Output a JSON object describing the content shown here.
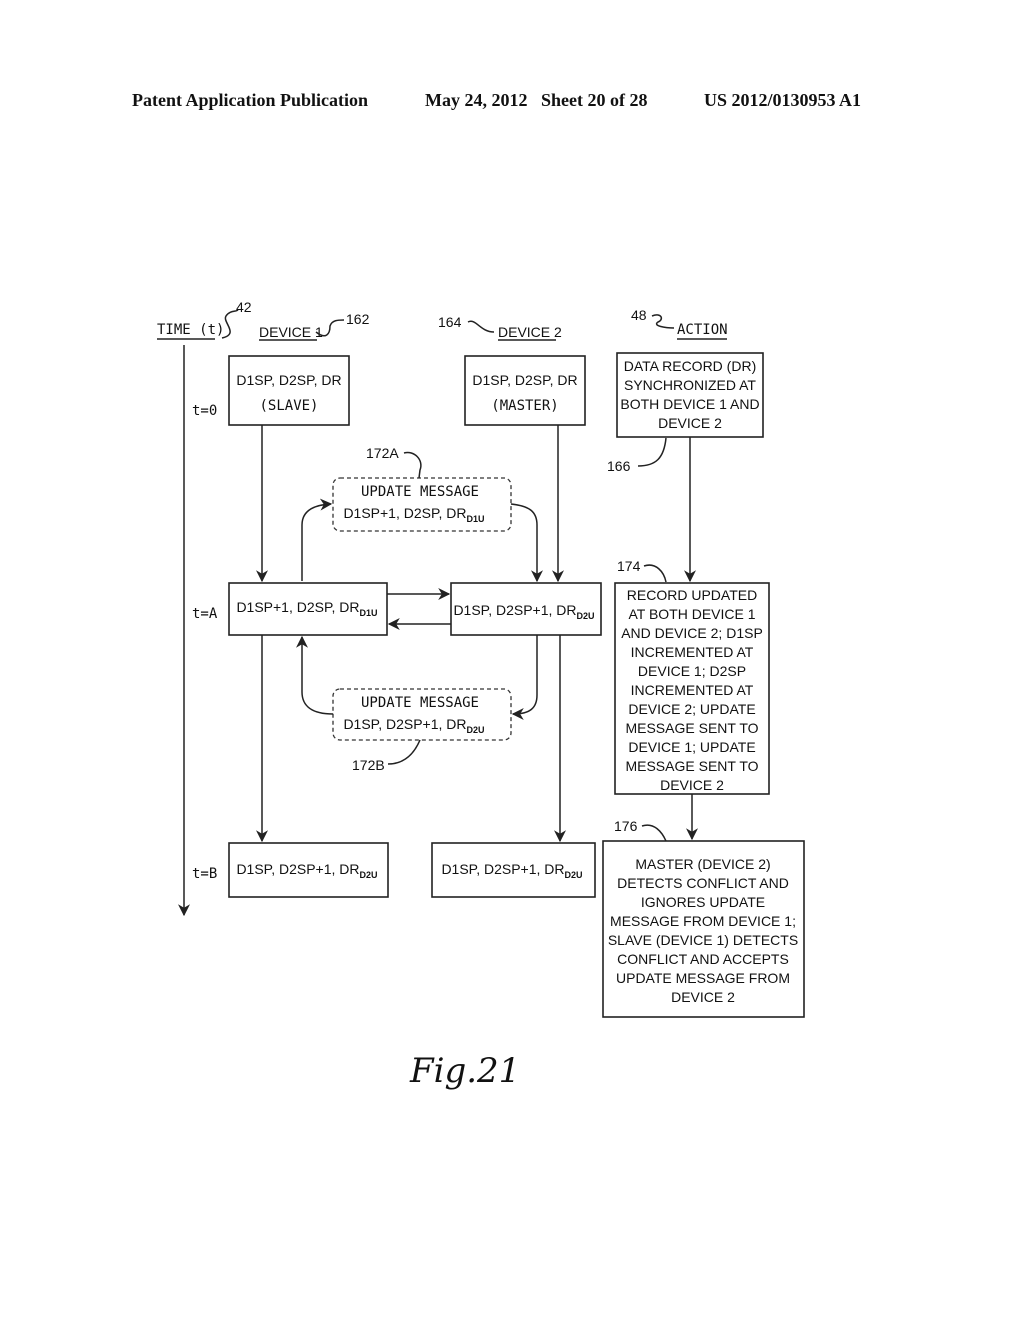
{
  "header": {
    "publication": "Patent Application Publication",
    "date_sheet": "May 24, 2012   Sheet 20 of 28",
    "patent_number": "US 2012/0130953 A1"
  },
  "columns": {
    "time": {
      "label": "TIME (t)",
      "ref": "42"
    },
    "device1": {
      "label": "DEVICE 1",
      "ref": "162"
    },
    "device2": {
      "label": "DEVICE 2",
      "ref": "164"
    },
    "action": {
      "label": "ACTION",
      "ref": "48"
    }
  },
  "time_marks": [
    "t=0",
    "t=A",
    "t=B"
  ],
  "t0": {
    "device1": {
      "line1": "D1SP, D2SP, DR",
      "line2": "(SLAVE)"
    },
    "device2": {
      "line1": "D1SP, D2SP, DR",
      "line2": "(MASTER)"
    },
    "action": {
      "ref": "166",
      "lines": [
        "DATA RECORD (DR)",
        "SYNCHRONIZED AT",
        "BOTH DEVICE 1 AND",
        "DEVICE 2"
      ]
    }
  },
  "update_a": {
    "ref": "172A",
    "title": "UPDATE MESSAGE",
    "text": "D1SP+1, D2SP, DR",
    "subscript": "D1U"
  },
  "tA": {
    "device1": {
      "text": "D1SP+1, D2SP, DR",
      "subscript": "D1U"
    },
    "device2": {
      "text": "D1SP, D2SP+1, DR",
      "subscript": "D2U"
    },
    "action": {
      "ref": "174",
      "lines": [
        "RECORD UPDATED",
        "AT BOTH DEVICE 1",
        "AND DEVICE 2; D1SP",
        "INCREMENTED AT",
        "DEVICE 1; D2SP",
        "INCREMENTED AT",
        "DEVICE 2; UPDATE",
        "MESSAGE SENT TO",
        "DEVICE 1; UPDATE",
        "MESSAGE SENT TO",
        "DEVICE 2"
      ]
    }
  },
  "update_b": {
    "ref": "172B",
    "title": "UPDATE MESSAGE",
    "text": "D1SP, D2SP+1, DR",
    "subscript": "D2U"
  },
  "tB": {
    "device1": {
      "text": "D1SP, D2SP+1, DR",
      "subscript": "D2U"
    },
    "device2": {
      "text": "D1SP, D2SP+1, DR",
      "subscript": "D2U"
    },
    "action": {
      "ref": "176",
      "lines": [
        "MASTER (DEVICE 2)",
        "DETECTS CONFLICT AND",
        "IGNORES UPDATE",
        "MESSAGE FROM DEVICE 1;",
        "SLAVE (DEVICE 1) DETECTS",
        "CONFLICT AND ACCEPTS",
        "UPDATE MESSAGE FROM",
        "DEVICE 2"
      ]
    }
  },
  "figure_label": "Fig.21"
}
